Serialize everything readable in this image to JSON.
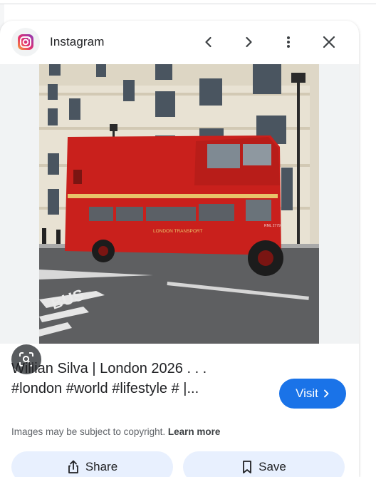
{
  "app": {
    "name": "Instagram"
  },
  "result": {
    "title_line1": "Willian Silva | London 2026 . . .",
    "title_line2": "#london #world #lifestyle # |...",
    "visit_label": "Visit",
    "copyright_text": "Images may be subject to copyright.",
    "learn_more_label": "Learn more"
  },
  "photo": {
    "bus_lettering": "LONDON TRANSPORT",
    "plate": "RML 2779",
    "road_text": "BUS"
  },
  "actions": {
    "share_label": "Share",
    "save_label": "Save"
  },
  "colors": {
    "accent": "#1a73e8",
    "action_bg": "#e8f0fe",
    "bus_red": "#c9201c"
  },
  "icons": [
    "instagram-icon",
    "chevron-left-icon",
    "chevron-right-icon",
    "more-vert-icon",
    "close-icon",
    "lens-icon",
    "chevron-right-small-icon",
    "share-icon",
    "bookmark-icon"
  ]
}
